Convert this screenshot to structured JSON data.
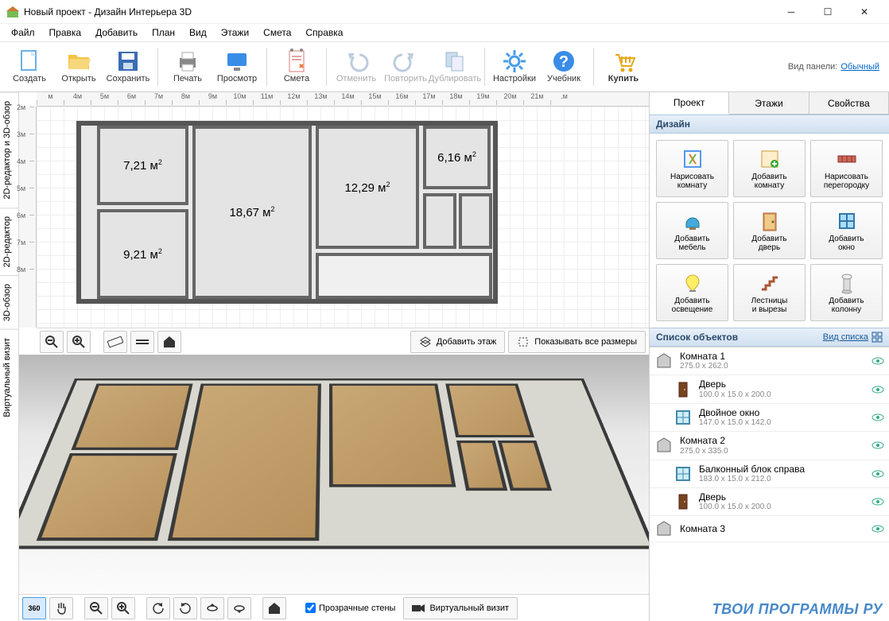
{
  "title": "Новый проект - Дизайн Интерьера 3D",
  "menu": [
    "Файл",
    "Правка",
    "Добавить",
    "План",
    "Вид",
    "Этажи",
    "Смета",
    "Справка"
  ],
  "toolbar": {
    "create": "Создать",
    "open": "Открыть",
    "save": "Сохранить",
    "print": "Печать",
    "preview": "Просмотр",
    "estimate": "Смета",
    "undo": "Отменить",
    "redo": "Повторить",
    "duplicate": "Дублировать",
    "settings": "Настройки",
    "tutorial": "Учебник",
    "buy": "Купить",
    "view_label": "Вид панели:",
    "view_mode": "Обычный"
  },
  "side_tabs": [
    "2D-редактор и 3D-обзор",
    "2D-редактор",
    "3D-обзор",
    "Виртуальный визит"
  ],
  "ruler_h": [
    "м",
    "4м",
    "5м",
    "6м",
    "7м",
    "8м",
    "9м",
    "10м",
    "11м",
    "12м",
    "13м",
    "14м",
    "15м",
    "16м",
    "17м",
    "18м",
    "19м",
    "20м",
    "21м",
    ".м"
  ],
  "ruler_v": [
    "2м",
    "3м",
    "4м",
    "5м",
    "6м",
    "7м",
    "8м"
  ],
  "rooms": {
    "r1": "7,21 м",
    "r2": "18,67 м",
    "r3": "12,29 м",
    "r4": "6,16 м",
    "r5": "9,21 м"
  },
  "top_btns": {
    "add_floor": "Добавить этаж",
    "show_dims": "Показывать все размеры"
  },
  "bottom_btns": {
    "transparent": "Прозрачные стены",
    "virtual": "Виртуальный визит",
    "rotate360": "360"
  },
  "right_tabs": [
    "Проект",
    "Этажи",
    "Свойства"
  ],
  "design_header": "Дизайн",
  "objects_header": "Список объектов",
  "objects_viewmode": "Вид списка",
  "design_btns": [
    "Нарисовать комнату",
    "Добавить комнату",
    "Нарисовать перегородку",
    "Добавить мебель",
    "Добавить дверь",
    "Добавить окно",
    "Добавить освещение",
    "Лестницы и вырезы",
    "Добавить колонну"
  ],
  "objects": [
    {
      "name": "Комната 1",
      "dims": "275.0 x 262.0",
      "type": "room"
    },
    {
      "name": "Дверь",
      "dims": "100.0 x 15.0 x 200.0",
      "type": "door",
      "child": true
    },
    {
      "name": "Двойное окно",
      "dims": "147.0 x 15.0 x 142.0",
      "type": "window",
      "child": true
    },
    {
      "name": "Комната 2",
      "dims": "275.0 x 335.0",
      "type": "room"
    },
    {
      "name": "Балконный блок справа",
      "dims": "183.0 x 15.0 x 212.0",
      "type": "window",
      "child": true
    },
    {
      "name": "Дверь",
      "dims": "100.0 x 15.0 x 200.0",
      "type": "door",
      "child": true
    },
    {
      "name": "Комната 3",
      "dims": "",
      "type": "room"
    }
  ],
  "watermark": "ТВОИ ПРОГРАММЫ РУ"
}
